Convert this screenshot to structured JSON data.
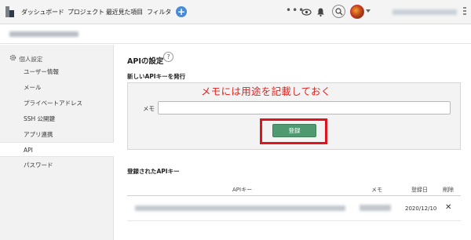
{
  "nav": {
    "items": [
      "ダッシュボード",
      "プロジェクト",
      "最近見た項目",
      "フィルタ"
    ],
    "add_icon": "+",
    "icons": [
      "more-dots-icon",
      "eye-icon",
      "bell-icon",
      "search-icon",
      "avatar",
      "chevron-down-icon"
    ]
  },
  "sidebar": {
    "heading": "個人設定",
    "items": [
      {
        "label": "ユーザー情報"
      },
      {
        "label": "メール"
      },
      {
        "label": "プライベートアドレス"
      },
      {
        "label": "SSH 公開鍵"
      },
      {
        "label": "アプリ連携"
      },
      {
        "label": "API"
      },
      {
        "label": "パスワード"
      }
    ],
    "active": "API"
  },
  "main": {
    "title": "APIの設定",
    "help": "?",
    "new_key_heading": "新しいAPIキーを発行",
    "annotation": "メモには用途を記載しておく",
    "memo_label": "メモ",
    "memo_value": "",
    "register_label": "登録",
    "registered_heading": "登録されたAPIキー",
    "table": {
      "headers": [
        "APIキー",
        "メモ",
        "登録日",
        "削除"
      ],
      "rows": [
        {
          "date": "2020/12/10",
          "delete": "✕"
        }
      ]
    }
  },
  "colors": {
    "accent": "#4a8bd6",
    "register_button": "#4f9a70",
    "annotation_red": "#e0241e"
  }
}
